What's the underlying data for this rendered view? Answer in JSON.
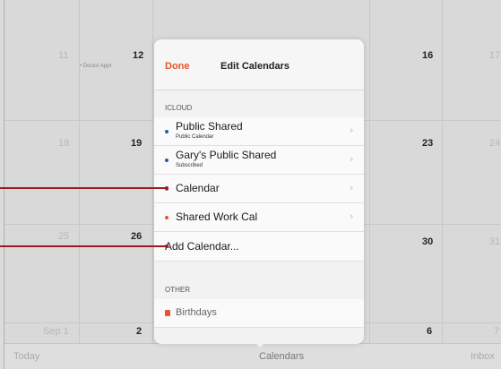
{
  "calendar": {
    "row1": [
      {
        "day": "11",
        "dim": true
      },
      {
        "day": "12",
        "dim": false,
        "event": "• Doctor Appt"
      },
      {
        "day": "16",
        "dim": false
      },
      {
        "day": "17",
        "dim": true
      }
    ],
    "row2": [
      {
        "day": "18",
        "dim": true
      },
      {
        "day": "19",
        "dim": false
      },
      {
        "day": "23",
        "dim": false
      },
      {
        "day": "24",
        "dim": true
      }
    ],
    "row3": [
      {
        "day": "25",
        "dim": true
      },
      {
        "day": "26",
        "dim": false
      },
      {
        "day": "30",
        "dim": false
      },
      {
        "day": "31",
        "dim": true
      }
    ],
    "row4": [
      {
        "day": "Sep 1",
        "dim": true
      },
      {
        "day": "2",
        "dim": false
      },
      {
        "day": "6",
        "dim": false
      },
      {
        "day": "7",
        "dim": true
      }
    ]
  },
  "tabbar": {
    "today": "Today",
    "calendars": "Calendars",
    "inbox": "Inbox"
  },
  "popover": {
    "done_label": "Done",
    "title": "Edit Calendars",
    "icloud_section": "ICLOUD",
    "other_section": "OTHER",
    "rows": [
      {
        "name": "Public Shared",
        "sub": "Public Calendar",
        "color": "#2a56b8",
        "chevron": "›"
      },
      {
        "name": "Gary's Public Shared",
        "sub": "Subscribed",
        "color": "#2a56b8",
        "chevron": "›"
      },
      {
        "name": "Calendar",
        "sub": "",
        "color": "#9b59b6",
        "chevron": "›"
      },
      {
        "name": "Shared Work Cal",
        "sub": "",
        "color": "#e8542c",
        "chevron": "›"
      }
    ],
    "add_calendar": "Add Calendar...",
    "birthdays": "Birthdays"
  },
  "colors": {
    "accent": "#e8542c",
    "callout": "#9a1b22"
  }
}
